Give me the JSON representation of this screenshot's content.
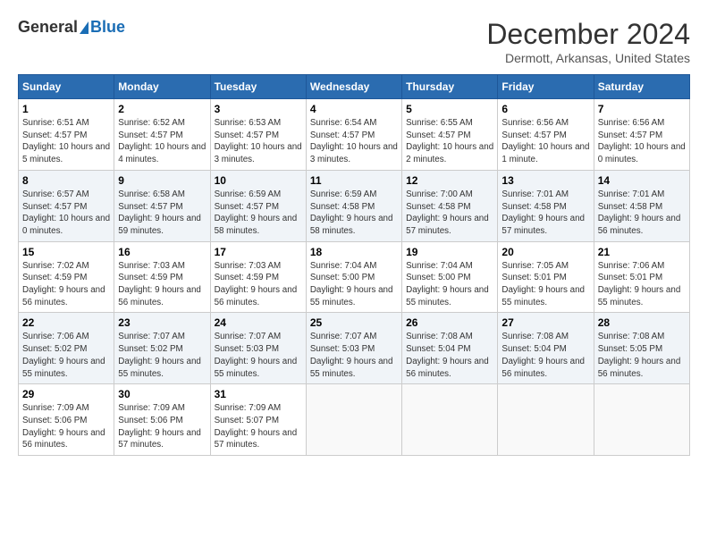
{
  "header": {
    "logo_general": "General",
    "logo_blue": "Blue",
    "month_title": "December 2024",
    "location": "Dermott, Arkansas, United States"
  },
  "weekdays": [
    "Sunday",
    "Monday",
    "Tuesday",
    "Wednesday",
    "Thursday",
    "Friday",
    "Saturday"
  ],
  "weeks": [
    [
      {
        "day": "1",
        "sunrise": "6:51 AM",
        "sunset": "4:57 PM",
        "daylight": "10 hours and 5 minutes."
      },
      {
        "day": "2",
        "sunrise": "6:52 AM",
        "sunset": "4:57 PM",
        "daylight": "10 hours and 4 minutes."
      },
      {
        "day": "3",
        "sunrise": "6:53 AM",
        "sunset": "4:57 PM",
        "daylight": "10 hours and 3 minutes."
      },
      {
        "day": "4",
        "sunrise": "6:54 AM",
        "sunset": "4:57 PM",
        "daylight": "10 hours and 3 minutes."
      },
      {
        "day": "5",
        "sunrise": "6:55 AM",
        "sunset": "4:57 PM",
        "daylight": "10 hours and 2 minutes."
      },
      {
        "day": "6",
        "sunrise": "6:56 AM",
        "sunset": "4:57 PM",
        "daylight": "10 hours and 1 minute."
      },
      {
        "day": "7",
        "sunrise": "6:56 AM",
        "sunset": "4:57 PM",
        "daylight": "10 hours and 0 minutes."
      }
    ],
    [
      {
        "day": "8",
        "sunrise": "6:57 AM",
        "sunset": "4:57 PM",
        "daylight": "10 hours and 0 minutes."
      },
      {
        "day": "9",
        "sunrise": "6:58 AM",
        "sunset": "4:57 PM",
        "daylight": "9 hours and 59 minutes."
      },
      {
        "day": "10",
        "sunrise": "6:59 AM",
        "sunset": "4:57 PM",
        "daylight": "9 hours and 58 minutes."
      },
      {
        "day": "11",
        "sunrise": "6:59 AM",
        "sunset": "4:58 PM",
        "daylight": "9 hours and 58 minutes."
      },
      {
        "day": "12",
        "sunrise": "7:00 AM",
        "sunset": "4:58 PM",
        "daylight": "9 hours and 57 minutes."
      },
      {
        "day": "13",
        "sunrise": "7:01 AM",
        "sunset": "4:58 PM",
        "daylight": "9 hours and 57 minutes."
      },
      {
        "day": "14",
        "sunrise": "7:01 AM",
        "sunset": "4:58 PM",
        "daylight": "9 hours and 56 minutes."
      }
    ],
    [
      {
        "day": "15",
        "sunrise": "7:02 AM",
        "sunset": "4:59 PM",
        "daylight": "9 hours and 56 minutes."
      },
      {
        "day": "16",
        "sunrise": "7:03 AM",
        "sunset": "4:59 PM",
        "daylight": "9 hours and 56 minutes."
      },
      {
        "day": "17",
        "sunrise": "7:03 AM",
        "sunset": "4:59 PM",
        "daylight": "9 hours and 56 minutes."
      },
      {
        "day": "18",
        "sunrise": "7:04 AM",
        "sunset": "5:00 PM",
        "daylight": "9 hours and 55 minutes."
      },
      {
        "day": "19",
        "sunrise": "7:04 AM",
        "sunset": "5:00 PM",
        "daylight": "9 hours and 55 minutes."
      },
      {
        "day": "20",
        "sunrise": "7:05 AM",
        "sunset": "5:01 PM",
        "daylight": "9 hours and 55 minutes."
      },
      {
        "day": "21",
        "sunrise": "7:06 AM",
        "sunset": "5:01 PM",
        "daylight": "9 hours and 55 minutes."
      }
    ],
    [
      {
        "day": "22",
        "sunrise": "7:06 AM",
        "sunset": "5:02 PM",
        "daylight": "9 hours and 55 minutes."
      },
      {
        "day": "23",
        "sunrise": "7:07 AM",
        "sunset": "5:02 PM",
        "daylight": "9 hours and 55 minutes."
      },
      {
        "day": "24",
        "sunrise": "7:07 AM",
        "sunset": "5:03 PM",
        "daylight": "9 hours and 55 minutes."
      },
      {
        "day": "25",
        "sunrise": "7:07 AM",
        "sunset": "5:03 PM",
        "daylight": "9 hours and 55 minutes."
      },
      {
        "day": "26",
        "sunrise": "7:08 AM",
        "sunset": "5:04 PM",
        "daylight": "9 hours and 56 minutes."
      },
      {
        "day": "27",
        "sunrise": "7:08 AM",
        "sunset": "5:04 PM",
        "daylight": "9 hours and 56 minutes."
      },
      {
        "day": "28",
        "sunrise": "7:08 AM",
        "sunset": "5:05 PM",
        "daylight": "9 hours and 56 minutes."
      }
    ],
    [
      {
        "day": "29",
        "sunrise": "7:09 AM",
        "sunset": "5:06 PM",
        "daylight": "9 hours and 56 minutes."
      },
      {
        "day": "30",
        "sunrise": "7:09 AM",
        "sunset": "5:06 PM",
        "daylight": "9 hours and 57 minutes."
      },
      {
        "day": "31",
        "sunrise": "7:09 AM",
        "sunset": "5:07 PM",
        "daylight": "9 hours and 57 minutes."
      },
      null,
      null,
      null,
      null
    ]
  ],
  "labels": {
    "sunrise": "Sunrise:",
    "sunset": "Sunset:",
    "daylight": "Daylight hours"
  }
}
